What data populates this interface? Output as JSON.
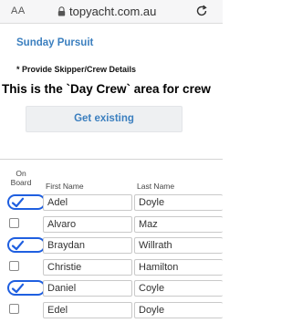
{
  "browser": {
    "text_size_label": "AA",
    "url": "topyacht.com.au"
  },
  "page": {
    "site_title": "Sunday Pursuit",
    "notice": "* Provide Skipper/Crew Details",
    "banner": "This is the `Day Crew` area for crew",
    "get_existing_label": "Get existing"
  },
  "table": {
    "headers": {
      "on_board": "On Board",
      "first_name": "First Name",
      "last_name": "Last Name"
    },
    "rows": [
      {
        "on_board": true,
        "first_name": "Adel",
        "last_name": "Doyle"
      },
      {
        "on_board": false,
        "first_name": "Alvaro",
        "last_name": "Maz"
      },
      {
        "on_board": true,
        "first_name": "Braydan",
        "last_name": "Willrath"
      },
      {
        "on_board": false,
        "first_name": "Christie",
        "last_name": "Hamilton"
      },
      {
        "on_board": true,
        "first_name": "Daniel",
        "last_name": "Coyle"
      },
      {
        "on_board": false,
        "first_name": "Edel",
        "last_name": "Doyle"
      }
    ]
  },
  "colors": {
    "accent": "#3b7fbf",
    "checkbox": "#1f5fe0"
  }
}
